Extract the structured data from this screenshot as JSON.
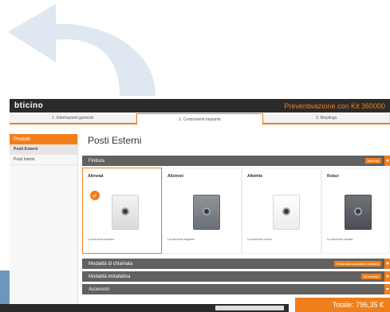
{
  "header": {
    "logo": "bticino",
    "title": "Preventivazione con Kit 360000"
  },
  "steps": [
    {
      "label": "1. Informazioni generali"
    },
    {
      "label": "2. Componenti impianto"
    },
    {
      "label": "3. Riepilogo"
    }
  ],
  "sidebar": {
    "heading": "Prodotti",
    "items": [
      {
        "label": "Posti Esterni"
      },
      {
        "label": "Posti Interni"
      }
    ]
  },
  "main": {
    "title": "Posti Esterni",
    "sections": [
      {
        "label": "Finitura",
        "tag": "Allmetal"
      },
      {
        "label": "Modalità di chiamata",
        "tag": "Chiamata a pulsanti o tastiera"
      },
      {
        "label": "Modalità installativa",
        "tag": "da incasso"
      },
      {
        "label": "Accessori",
        "tag": ""
      }
    ],
    "cards": [
      {
        "name": "Allmetal",
        "desc": "La soluzione classica"
      },
      {
        "name": "Allstreet",
        "desc": "La soluzione elegante"
      },
      {
        "name": "Allwhite",
        "desc": "La soluzione neutra"
      },
      {
        "name": "Robur",
        "desc": "La soluzione robusta"
      }
    ]
  },
  "total": "Totale: 796,35 €",
  "colors": {
    "accent": "#f07f1b",
    "dark": "#2b2b2b",
    "section_bar": "#616161"
  }
}
